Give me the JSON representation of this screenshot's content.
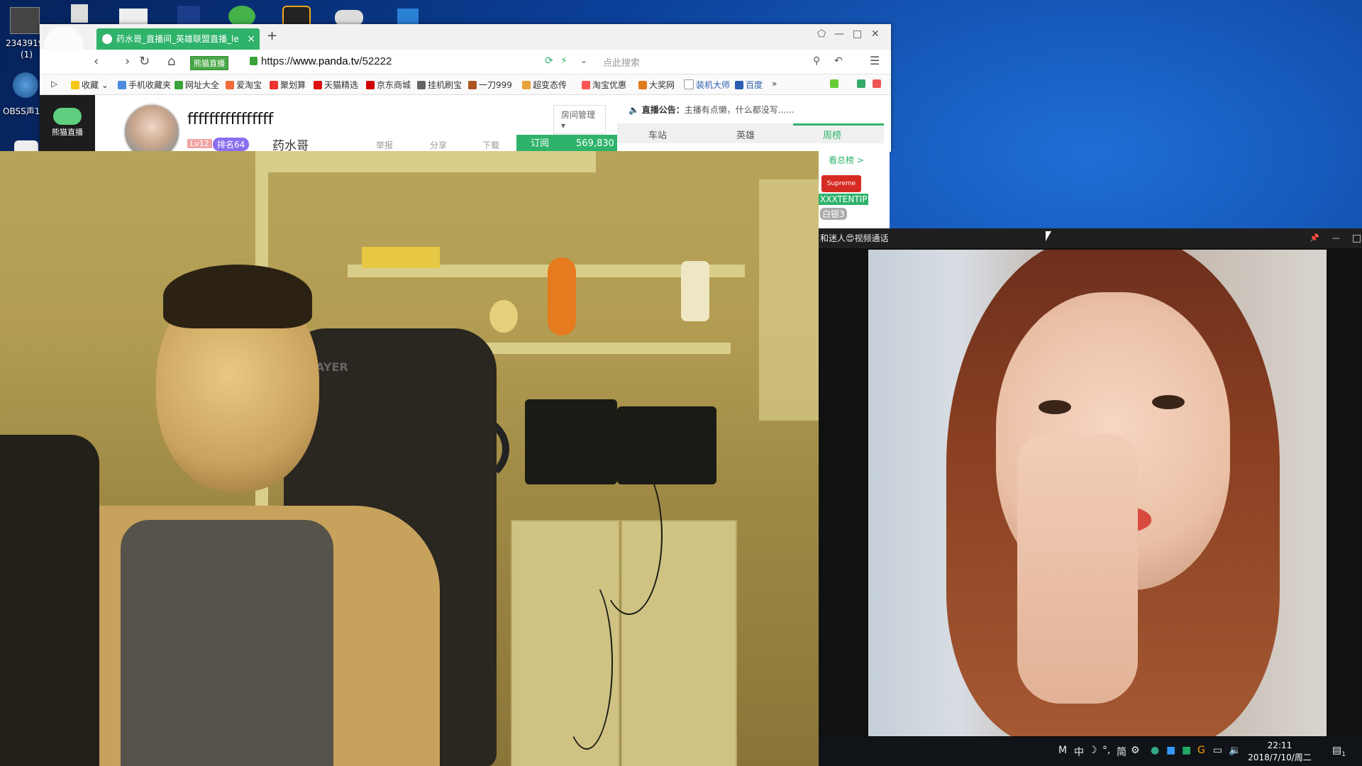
{
  "desktop": {
    "icon1_label": "2343919",
    "icon1_sub": "(1)",
    "icon2_label": "OBSS声1"
  },
  "browser": {
    "tab_title": "药水哥_直播间_英雄联盟直播_le",
    "tab_close": "×",
    "new_tab": "+",
    "speed_badge": "熊猫直播",
    "url_protocol": "https://",
    "url_host": "www.panda.tv",
    "url_path": "/52222",
    "search_placeholder": "点此搜索",
    "bookmarks": [
      "收藏",
      "手机收藏夹",
      "网址大全",
      "爱淘宝",
      "聚划算",
      "天猫精选",
      "京东商城",
      "挂机刷宝",
      "一刀999",
      "超变态传",
      "淘宝优惠",
      "大奖网",
      "装机大师",
      "百度"
    ],
    "more": "»"
  },
  "page": {
    "site_name": "熊猫直播",
    "room_title": "ffffffffffffffff",
    "level": "Lv12",
    "rank": "排名64",
    "anchor_name": "药水哥",
    "report": "举报",
    "share": "分享",
    "download": "下载",
    "room_manage": "房间管理",
    "subscribe_label": "订阅",
    "subscribe_count": "569,830",
    "notice_label": "直播公告：",
    "notice_text": "主播有点懒，什么都没写......",
    "tabs": [
      "车站",
      "英雄",
      "周榜"
    ],
    "see_rank": "看总榜 >",
    "supreme": "Supreme",
    "fan_name": "XXXTENTIP",
    "fan_badge": "白银3"
  },
  "call_window": {
    "title": "和迷人😍视频通话",
    "pin": "📌",
    "minimize": "—",
    "maximize": "□"
  },
  "taskbar": {
    "ime": "M",
    "lang": "中",
    "mode": "简",
    "time": "22:11",
    "date": "2018/7/10/周二",
    "notify": "1"
  },
  "colors": {
    "panda_green": "#2fb36b",
    "desktop_blue": "#0b3f98"
  }
}
